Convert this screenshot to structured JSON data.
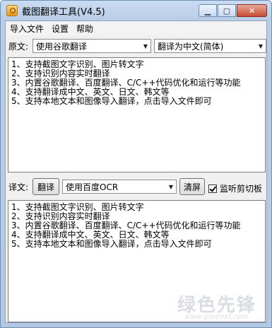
{
  "window": {
    "title": "截图翻译工具(V4.5)"
  },
  "menu": {
    "items": [
      "导入文件",
      "设置",
      "帮助"
    ]
  },
  "source": {
    "label": "原文:",
    "engine": "使用谷歌翻译",
    "target_lang": "翻译为中文(简体)",
    "text": "1、支持截图文字识别、图片转文字\n2、支持识别内容实时翻译\n3、内置谷歌翻译、百度翻译、C/C++代码优化和运行等功能\n4、支持翻译成中文、英文、日文、韩文等\n5、支持本地文本和图像导入翻译，点击导入文件即可"
  },
  "translation": {
    "label": "译文:",
    "translate_button": "翻译",
    "ocr_engine": "使用百度OCR",
    "clear_button": "清屏",
    "clipboard_checkbox": {
      "label": "监听剪切板",
      "checked": true
    },
    "text": "1、支持截图文字识别、图片转文字\n2、支持识别内容实时翻译\n3、内置谷歌翻译、百度翻译、C/C++代码优化和运行等功能\n4、支持翻译成中文、英文、日文、韩文等\n5、支持本地文本和图像导入翻译，点击导入文件即可"
  },
  "watermark": {
    "text": "绿色先锋",
    "url": "www.greenxf.com"
  },
  "icons": {
    "app": "app-icon",
    "minimize": "minimize-icon",
    "maximize": "maximize-icon",
    "close": "close-icon",
    "dropdown": "chevron-down-icon",
    "checkbox": "checkmark-icon"
  }
}
